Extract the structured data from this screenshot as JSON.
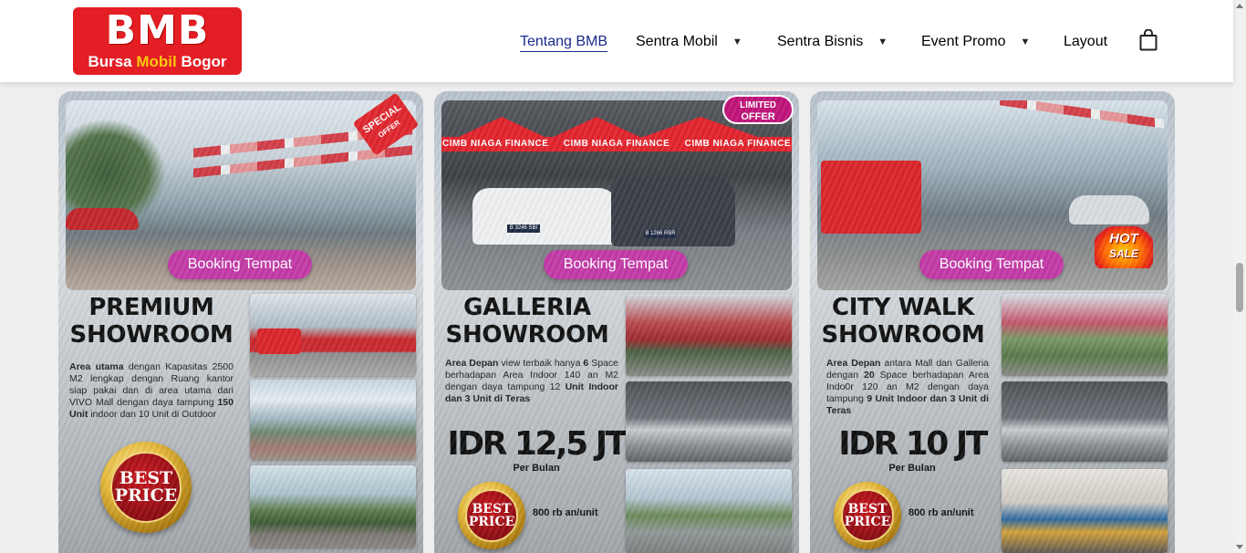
{
  "header": {
    "logo": {
      "top": "BMB",
      "bottom_left": "Bursa ",
      "bottom_mid": "Mobil",
      "bottom_right": " Bogor"
    },
    "nav": [
      {
        "label": "Tentang BMB",
        "active": true,
        "dropdown": false
      },
      {
        "label": "Sentra Mobil",
        "active": false,
        "dropdown": true
      },
      {
        "label": "Sentra Bisnis",
        "active": false,
        "dropdown": true
      },
      {
        "label": "Event Promo",
        "active": false,
        "dropdown": true
      },
      {
        "label": "Layout",
        "active": false,
        "dropdown": false
      }
    ],
    "cart_icon": "shopping-bag-icon",
    "caret_glyph": "▼"
  },
  "cards": [
    {
      "booking_label": "Booking Tempat",
      "badge": {
        "line1": "SPECIAL",
        "line2": "OFFER"
      },
      "title_line1": "PREMIUM",
      "title_line2": "SHOWROOM",
      "desc": [
        {
          "bold": true,
          "text": "Area utama"
        },
        {
          "bold": false,
          "text": " dengan Kapasitas 2500 M2 lengkap dengan Ruang kantor siap pakai dan di area utama dari VIVO Mall dengan daya tampung "
        },
        {
          "bold": true,
          "text": "150 Unit"
        },
        {
          "bold": false,
          "text": " indoor dan 10 Unit di Outdoor"
        }
      ],
      "best_line1": "BEST",
      "best_line2": "PRICE"
    },
    {
      "booking_label": "Booking Tempat",
      "tent_label": "CIMB NIAGA FINANCE",
      "plate_1": "B 3246 SBI",
      "plate_2": "B 1266 RBR",
      "badge": {
        "line1": "LIMITED",
        "line2": "OFFER"
      },
      "title_line1": "GALLERIA",
      "title_line2": "SHOWROOM",
      "desc": [
        {
          "bold": true,
          "text": "Area Depan"
        },
        {
          "bold": false,
          "text": " view terbaik hanya "
        },
        {
          "bold": true,
          "text": "6"
        },
        {
          "bold": false,
          "text": " Space berhadapan Area Indoor 140 an M2 dengan daya tampung 12 "
        },
        {
          "bold": true,
          "text": "Unit Indoor dan 3 Unit di Teras"
        }
      ],
      "price": "IDR 12,5 JT",
      "per": "Per Bulan",
      "unit_price": "800 rb an/unit",
      "best_line1": "BEST",
      "best_line2": "PRICE"
    },
    {
      "booking_label": "Booking Tempat",
      "badge": {
        "line1": "HOT",
        "line2": "SALE"
      },
      "title_line1": "CITY WALK",
      "title_line2": "SHOWROOM",
      "desc": [
        {
          "bold": true,
          "text": "Area Depan"
        },
        {
          "bold": false,
          "text": " antara Mall dan Galleria dengan "
        },
        {
          "bold": true,
          "text": "20"
        },
        {
          "bold": false,
          "text": " Space berhadapan Area Indo0r 120 an M2 dengan daya tampung "
        },
        {
          "bold": true,
          "text": "9 Unit Indoor dan 3 Unit di Teras"
        }
      ],
      "price": "IDR 10 JT",
      "per": "Per Bulan",
      "unit_price": "800 rb an/unit",
      "best_line1": "BEST",
      "best_line2": "PRICE"
    }
  ]
}
